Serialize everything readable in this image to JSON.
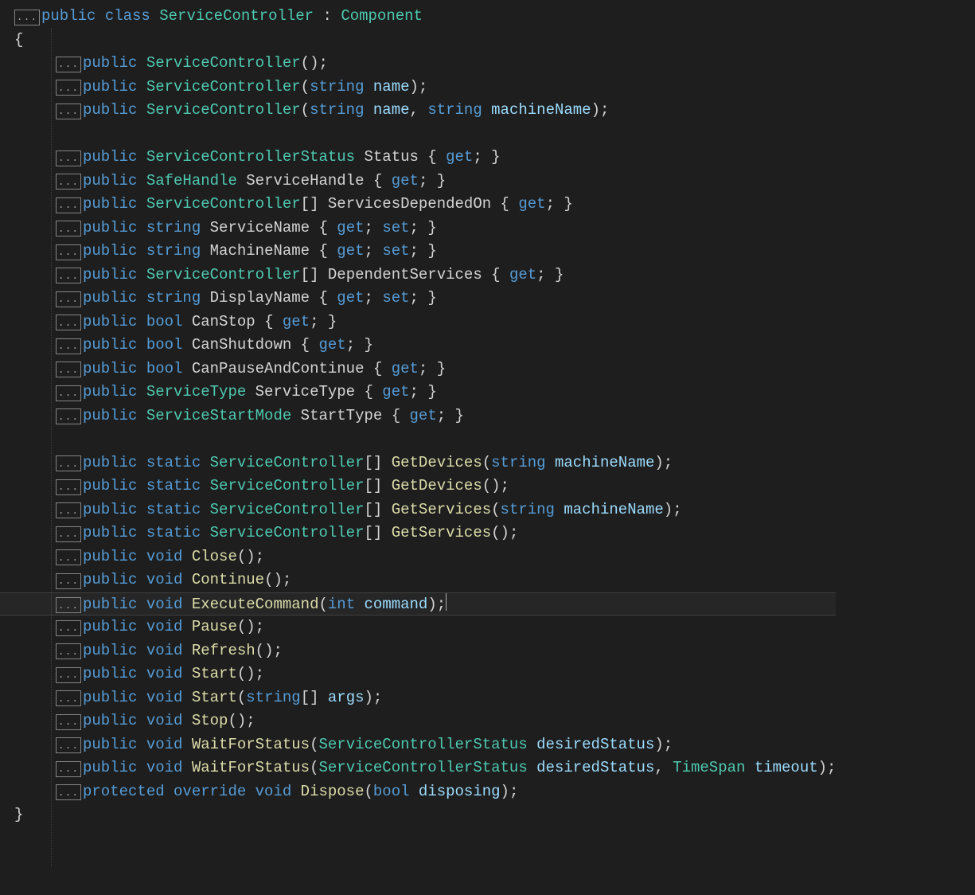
{
  "foldGlyph": "...",
  "caretLine": 25,
  "lines": [
    {
      "fold": true,
      "indent": 0,
      "tokens": [
        [
          "kw",
          "public"
        ],
        [
          "pn",
          " "
        ],
        [
          "kw",
          "class"
        ],
        [
          "pn",
          " "
        ],
        [
          "type",
          "ServiceController"
        ],
        [
          "pn",
          " : "
        ],
        [
          "type",
          "Component"
        ]
      ]
    },
    {
      "fold": false,
      "brace": "{",
      "indent": 0
    },
    {
      "fold": true,
      "indent": 1,
      "tokens": [
        [
          "kw",
          "public"
        ],
        [
          "pn",
          " "
        ],
        [
          "type",
          "ServiceController"
        ],
        [
          "pn",
          "();"
        ]
      ]
    },
    {
      "fold": true,
      "indent": 1,
      "tokens": [
        [
          "kw",
          "public"
        ],
        [
          "pn",
          " "
        ],
        [
          "type",
          "ServiceController"
        ],
        [
          "pn",
          "("
        ],
        [
          "kw",
          "string"
        ],
        [
          "pn",
          " "
        ],
        [
          "id",
          "name"
        ],
        [
          "pn",
          ");"
        ]
      ]
    },
    {
      "fold": true,
      "indent": 1,
      "tokens": [
        [
          "kw",
          "public"
        ],
        [
          "pn",
          " "
        ],
        [
          "type",
          "ServiceController"
        ],
        [
          "pn",
          "("
        ],
        [
          "kw",
          "string"
        ],
        [
          "pn",
          " "
        ],
        [
          "id",
          "name"
        ],
        [
          "pn",
          ", "
        ],
        [
          "kw",
          "string"
        ],
        [
          "pn",
          " "
        ],
        [
          "id",
          "machineName"
        ],
        [
          "pn",
          ");"
        ]
      ]
    },
    {
      "blank": true
    },
    {
      "fold": true,
      "indent": 1,
      "tokens": [
        [
          "kw",
          "public"
        ],
        [
          "pn",
          " "
        ],
        [
          "type",
          "ServiceControllerStatus"
        ],
        [
          "pn",
          " "
        ],
        [
          "pn",
          "Status"
        ],
        [
          "pn",
          " { "
        ],
        [
          "kw",
          "get"
        ],
        [
          "pn",
          "; }"
        ]
      ]
    },
    {
      "fold": true,
      "indent": 1,
      "tokens": [
        [
          "kw",
          "public"
        ],
        [
          "pn",
          " "
        ],
        [
          "type",
          "SafeHandle"
        ],
        [
          "pn",
          " "
        ],
        [
          "pn",
          "ServiceHandle"
        ],
        [
          "pn",
          " { "
        ],
        [
          "kw",
          "get"
        ],
        [
          "pn",
          "; }"
        ]
      ]
    },
    {
      "fold": true,
      "indent": 1,
      "tokens": [
        [
          "kw",
          "public"
        ],
        [
          "pn",
          " "
        ],
        [
          "type",
          "ServiceController"
        ],
        [
          "pn",
          "[] "
        ],
        [
          "pn",
          "ServicesDependedOn"
        ],
        [
          "pn",
          " { "
        ],
        [
          "kw",
          "get"
        ],
        [
          "pn",
          "; }"
        ]
      ]
    },
    {
      "fold": true,
      "indent": 1,
      "tokens": [
        [
          "kw",
          "public"
        ],
        [
          "pn",
          " "
        ],
        [
          "kw",
          "string"
        ],
        [
          "pn",
          " "
        ],
        [
          "pn",
          "ServiceName"
        ],
        [
          "pn",
          " { "
        ],
        [
          "kw",
          "get"
        ],
        [
          "pn",
          "; "
        ],
        [
          "kw",
          "set"
        ],
        [
          "pn",
          "; }"
        ]
      ]
    },
    {
      "fold": true,
      "indent": 1,
      "tokens": [
        [
          "kw",
          "public"
        ],
        [
          "pn",
          " "
        ],
        [
          "kw",
          "string"
        ],
        [
          "pn",
          " "
        ],
        [
          "pn",
          "MachineName"
        ],
        [
          "pn",
          " { "
        ],
        [
          "kw",
          "get"
        ],
        [
          "pn",
          "; "
        ],
        [
          "kw",
          "set"
        ],
        [
          "pn",
          "; }"
        ]
      ]
    },
    {
      "fold": true,
      "indent": 1,
      "tokens": [
        [
          "kw",
          "public"
        ],
        [
          "pn",
          " "
        ],
        [
          "type",
          "ServiceController"
        ],
        [
          "pn",
          "[] "
        ],
        [
          "pn",
          "DependentServices"
        ],
        [
          "pn",
          " { "
        ],
        [
          "kw",
          "get"
        ],
        [
          "pn",
          "; }"
        ]
      ]
    },
    {
      "fold": true,
      "indent": 1,
      "tokens": [
        [
          "kw",
          "public"
        ],
        [
          "pn",
          " "
        ],
        [
          "kw",
          "string"
        ],
        [
          "pn",
          " "
        ],
        [
          "pn",
          "DisplayName"
        ],
        [
          "pn",
          " { "
        ],
        [
          "kw",
          "get"
        ],
        [
          "pn",
          "; "
        ],
        [
          "kw",
          "set"
        ],
        [
          "pn",
          "; }"
        ]
      ]
    },
    {
      "fold": true,
      "indent": 1,
      "tokens": [
        [
          "kw",
          "public"
        ],
        [
          "pn",
          " "
        ],
        [
          "kw",
          "bool"
        ],
        [
          "pn",
          " "
        ],
        [
          "pn",
          "CanStop"
        ],
        [
          "pn",
          " { "
        ],
        [
          "kw",
          "get"
        ],
        [
          "pn",
          "; }"
        ]
      ]
    },
    {
      "fold": true,
      "indent": 1,
      "tokens": [
        [
          "kw",
          "public"
        ],
        [
          "pn",
          " "
        ],
        [
          "kw",
          "bool"
        ],
        [
          "pn",
          " "
        ],
        [
          "pn",
          "CanShutdown"
        ],
        [
          "pn",
          " { "
        ],
        [
          "kw",
          "get"
        ],
        [
          "pn",
          "; }"
        ]
      ]
    },
    {
      "fold": true,
      "indent": 1,
      "tokens": [
        [
          "kw",
          "public"
        ],
        [
          "pn",
          " "
        ],
        [
          "kw",
          "bool"
        ],
        [
          "pn",
          " "
        ],
        [
          "pn",
          "CanPauseAndContinue"
        ],
        [
          "pn",
          " { "
        ],
        [
          "kw",
          "get"
        ],
        [
          "pn",
          "; }"
        ]
      ]
    },
    {
      "fold": true,
      "indent": 1,
      "tokens": [
        [
          "kw",
          "public"
        ],
        [
          "pn",
          " "
        ],
        [
          "type",
          "ServiceType"
        ],
        [
          "pn",
          " "
        ],
        [
          "pn",
          "ServiceType"
        ],
        [
          "pn",
          " { "
        ],
        [
          "kw",
          "get"
        ],
        [
          "pn",
          "; }"
        ]
      ]
    },
    {
      "fold": true,
      "indent": 1,
      "tokens": [
        [
          "kw",
          "public"
        ],
        [
          "pn",
          " "
        ],
        [
          "type",
          "ServiceStartMode"
        ],
        [
          "pn",
          " "
        ],
        [
          "pn",
          "StartType"
        ],
        [
          "pn",
          " { "
        ],
        [
          "kw",
          "get"
        ],
        [
          "pn",
          "; }"
        ]
      ]
    },
    {
      "blank": true
    },
    {
      "fold": true,
      "indent": 1,
      "tokens": [
        [
          "kw",
          "public"
        ],
        [
          "pn",
          " "
        ],
        [
          "kw",
          "static"
        ],
        [
          "pn",
          " "
        ],
        [
          "type",
          "ServiceController"
        ],
        [
          "pn",
          "[] "
        ],
        [
          "mth",
          "GetDevices"
        ],
        [
          "pn",
          "("
        ],
        [
          "kw",
          "string"
        ],
        [
          "pn",
          " "
        ],
        [
          "id",
          "machineName"
        ],
        [
          "pn",
          ");"
        ]
      ]
    },
    {
      "fold": true,
      "indent": 1,
      "tokens": [
        [
          "kw",
          "public"
        ],
        [
          "pn",
          " "
        ],
        [
          "kw",
          "static"
        ],
        [
          "pn",
          " "
        ],
        [
          "type",
          "ServiceController"
        ],
        [
          "pn",
          "[] "
        ],
        [
          "mth",
          "GetDevices"
        ],
        [
          "pn",
          "();"
        ]
      ]
    },
    {
      "fold": true,
      "indent": 1,
      "tokens": [
        [
          "kw",
          "public"
        ],
        [
          "pn",
          " "
        ],
        [
          "kw",
          "static"
        ],
        [
          "pn",
          " "
        ],
        [
          "type",
          "ServiceController"
        ],
        [
          "pn",
          "[] "
        ],
        [
          "mth",
          "GetServices"
        ],
        [
          "pn",
          "("
        ],
        [
          "kw",
          "string"
        ],
        [
          "pn",
          " "
        ],
        [
          "id",
          "machineName"
        ],
        [
          "pn",
          ");"
        ]
      ]
    },
    {
      "fold": true,
      "indent": 1,
      "tokens": [
        [
          "kw",
          "public"
        ],
        [
          "pn",
          " "
        ],
        [
          "kw",
          "static"
        ],
        [
          "pn",
          " "
        ],
        [
          "type",
          "ServiceController"
        ],
        [
          "pn",
          "[] "
        ],
        [
          "mth",
          "GetServices"
        ],
        [
          "pn",
          "();"
        ]
      ]
    },
    {
      "fold": true,
      "indent": 1,
      "tokens": [
        [
          "kw",
          "public"
        ],
        [
          "pn",
          " "
        ],
        [
          "kw",
          "void"
        ],
        [
          "pn",
          " "
        ],
        [
          "mth",
          "Close"
        ],
        [
          "pn",
          "();"
        ]
      ]
    },
    {
      "fold": true,
      "indent": 1,
      "tokens": [
        [
          "kw",
          "public"
        ],
        [
          "pn",
          " "
        ],
        [
          "kw",
          "void"
        ],
        [
          "pn",
          " "
        ],
        [
          "mth",
          "Continue"
        ],
        [
          "pn",
          "();"
        ]
      ]
    },
    {
      "fold": true,
      "indent": 1,
      "current": true,
      "caret": true,
      "tokens": [
        [
          "kw",
          "public"
        ],
        [
          "pn",
          " "
        ],
        [
          "kw",
          "void"
        ],
        [
          "pn",
          " "
        ],
        [
          "mth",
          "ExecuteCommand"
        ],
        [
          "pn",
          "("
        ],
        [
          "kw",
          "int"
        ],
        [
          "pn",
          " "
        ],
        [
          "id",
          "command"
        ],
        [
          "pn",
          ");"
        ]
      ]
    },
    {
      "fold": true,
      "indent": 1,
      "tokens": [
        [
          "kw",
          "public"
        ],
        [
          "pn",
          " "
        ],
        [
          "kw",
          "void"
        ],
        [
          "pn",
          " "
        ],
        [
          "mth",
          "Pause"
        ],
        [
          "pn",
          "();"
        ]
      ]
    },
    {
      "fold": true,
      "indent": 1,
      "tokens": [
        [
          "kw",
          "public"
        ],
        [
          "pn",
          " "
        ],
        [
          "kw",
          "void"
        ],
        [
          "pn",
          " "
        ],
        [
          "mth",
          "Refresh"
        ],
        [
          "pn",
          "();"
        ]
      ]
    },
    {
      "fold": true,
      "indent": 1,
      "tokens": [
        [
          "kw",
          "public"
        ],
        [
          "pn",
          " "
        ],
        [
          "kw",
          "void"
        ],
        [
          "pn",
          " "
        ],
        [
          "mth",
          "Start"
        ],
        [
          "pn",
          "();"
        ]
      ]
    },
    {
      "fold": true,
      "indent": 1,
      "tokens": [
        [
          "kw",
          "public"
        ],
        [
          "pn",
          " "
        ],
        [
          "kw",
          "void"
        ],
        [
          "pn",
          " "
        ],
        [
          "mth",
          "Start"
        ],
        [
          "pn",
          "("
        ],
        [
          "kw",
          "string"
        ],
        [
          "pn",
          "[] "
        ],
        [
          "id",
          "args"
        ],
        [
          "pn",
          ");"
        ]
      ]
    },
    {
      "fold": true,
      "indent": 1,
      "tokens": [
        [
          "kw",
          "public"
        ],
        [
          "pn",
          " "
        ],
        [
          "kw",
          "void"
        ],
        [
          "pn",
          " "
        ],
        [
          "mth",
          "Stop"
        ],
        [
          "pn",
          "();"
        ]
      ]
    },
    {
      "fold": true,
      "indent": 1,
      "tokens": [
        [
          "kw",
          "public"
        ],
        [
          "pn",
          " "
        ],
        [
          "kw",
          "void"
        ],
        [
          "pn",
          " "
        ],
        [
          "mth",
          "WaitForStatus"
        ],
        [
          "pn",
          "("
        ],
        [
          "type",
          "ServiceControllerStatus"
        ],
        [
          "pn",
          " "
        ],
        [
          "id",
          "desiredStatus"
        ],
        [
          "pn",
          ");"
        ]
      ]
    },
    {
      "fold": true,
      "indent": 1,
      "tokens": [
        [
          "kw",
          "public"
        ],
        [
          "pn",
          " "
        ],
        [
          "kw",
          "void"
        ],
        [
          "pn",
          " "
        ],
        [
          "mth",
          "WaitForStatus"
        ],
        [
          "pn",
          "("
        ],
        [
          "type",
          "ServiceControllerStatus"
        ],
        [
          "pn",
          " "
        ],
        [
          "id",
          "desiredStatus"
        ],
        [
          "pn",
          ", "
        ],
        [
          "type",
          "TimeSpan"
        ],
        [
          "pn",
          " "
        ],
        [
          "id",
          "timeout"
        ],
        [
          "pn",
          ");"
        ]
      ]
    },
    {
      "fold": true,
      "indent": 1,
      "tokens": [
        [
          "kw",
          "protected"
        ],
        [
          "pn",
          " "
        ],
        [
          "kw",
          "override"
        ],
        [
          "pn",
          " "
        ],
        [
          "kw",
          "void"
        ],
        [
          "pn",
          " "
        ],
        [
          "mth",
          "Dispose"
        ],
        [
          "pn",
          "("
        ],
        [
          "kw",
          "bool"
        ],
        [
          "pn",
          " "
        ],
        [
          "id",
          "disposing"
        ],
        [
          "pn",
          ");"
        ]
      ]
    },
    {
      "fold": false,
      "brace": "}",
      "indent": 0
    }
  ]
}
